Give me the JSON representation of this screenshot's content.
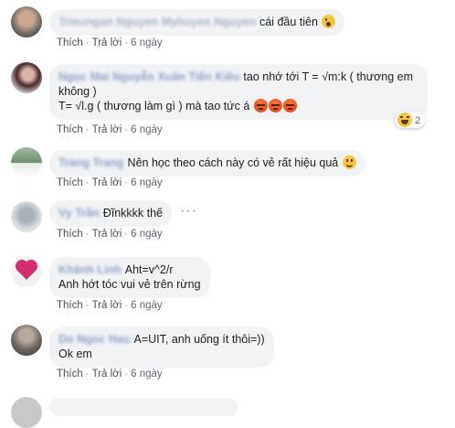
{
  "actions": {
    "like": "Thích",
    "reply": "Trả lời",
    "time": "6 ngày",
    "sep": "·"
  },
  "comments": [
    {
      "author": "Trieungan Nguyen Myhuyen Nguyen",
      "lines": [
        "cái đầu tiên"
      ],
      "emoji": "astonished-emoji"
    },
    {
      "author": "Ngọc Mai Nguyễn Xuân Tiến Kiều",
      "lines": [
        "tao nhớ tới T = √m:k ( thương em",
        "không )",
        "T= √l.g ( thương làm gì ) mà tao tức á"
      ],
      "emoji": "angry-emoji x3",
      "reaction_count": "2"
    },
    {
      "author": "Trang Trang",
      "lines": [
        "Nên học theo cách này có vẻ rất hiệu quả"
      ],
      "emoji": "smile-emoji"
    },
    {
      "author": "Vy Trần",
      "lines": [
        "Đĩnkkkk thế"
      ]
    },
    {
      "author": "Khánh Linh",
      "lines": [
        "Aht=v^2/r",
        "Anh hớt tóc vui vẻ trên rừng"
      ]
    },
    {
      "author": "Do Ngoc Hau",
      "lines": [
        "A=UIT, anh uống ít thôi=))",
        "Ok em"
      ]
    }
  ]
}
